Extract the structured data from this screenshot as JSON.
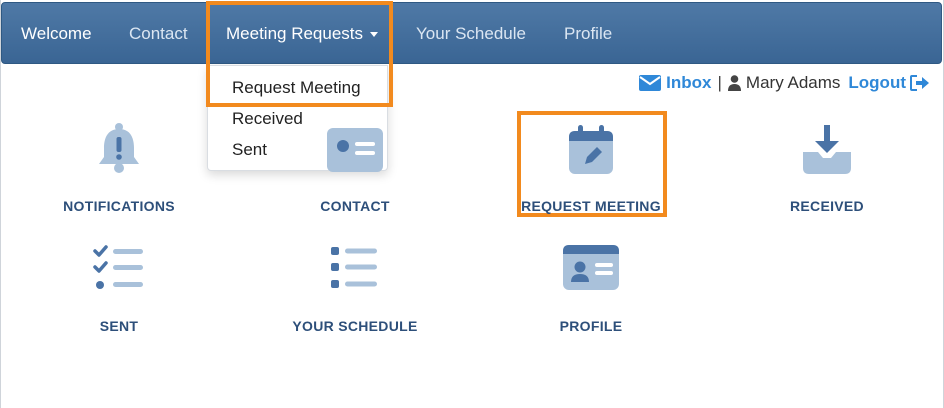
{
  "navbar": {
    "brand": "Welcome",
    "items": [
      {
        "label": "Contact"
      },
      {
        "label": "Meeting Requests"
      },
      {
        "label": "Your Schedule"
      },
      {
        "label": "Profile"
      }
    ]
  },
  "dropdown": {
    "items": [
      {
        "label": "Request Meeting"
      },
      {
        "label": "Received"
      },
      {
        "label": "Sent"
      }
    ]
  },
  "userbar": {
    "inbox": "Inbox",
    "separator": "|",
    "user": "Mary Adams",
    "logout": "Logout"
  },
  "tiles": [
    {
      "label": "NOTIFICATIONS",
      "icon": "bell-icon"
    },
    {
      "label": "CONTACT",
      "icon": "contact-card-icon"
    },
    {
      "label": "REQUEST MEETING",
      "icon": "calendar-edit-icon"
    },
    {
      "label": "RECEIVED",
      "icon": "inbox-download-icon"
    },
    {
      "label": "SENT",
      "icon": "checklist-icon"
    },
    {
      "label": "YOUR SCHEDULE",
      "icon": "list-icon"
    },
    {
      "label": "PROFILE",
      "icon": "id-card-icon"
    }
  ],
  "colors": {
    "navbar": "#3f6b9b",
    "highlight": "#f28a1e",
    "tile_label": "#2d4f7a",
    "icon_dark": "#4a73a6",
    "icon_light": "#a9c1da",
    "link": "#2f88d8"
  }
}
